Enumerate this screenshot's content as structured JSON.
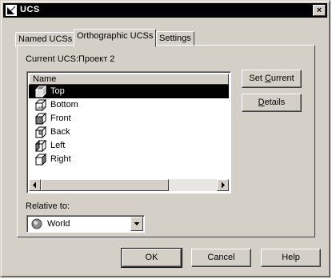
{
  "window": {
    "title": "UCS",
    "close_glyph": "×"
  },
  "tabs": [
    {
      "label": "Named UCSs"
    },
    {
      "label": "Orthographic UCSs",
      "active": true
    },
    {
      "label": "Settings"
    }
  ],
  "current_ucs": {
    "label": "Current UCS:",
    "value": "Проект 2"
  },
  "list": {
    "header": "Name",
    "items": [
      {
        "label": "Top",
        "icon": "cube-top-icon",
        "selected": true
      },
      {
        "label": "Bottom",
        "icon": "cube-bottom-icon"
      },
      {
        "label": "Front",
        "icon": "cube-front-icon"
      },
      {
        "label": "Back",
        "icon": "cube-back-icon"
      },
      {
        "label": "Left",
        "icon": "cube-left-icon"
      },
      {
        "label": "Right",
        "icon": "cube-right-icon"
      }
    ]
  },
  "side_buttons": {
    "set_current": {
      "pre": "Set ",
      "acc": "C",
      "post": "urrent"
    },
    "details": {
      "pre": "",
      "acc": "D",
      "post": "etails"
    }
  },
  "relative_to": {
    "label": "Relative to:",
    "value": "World",
    "icon": "globe-icon"
  },
  "footer": {
    "ok": "OK",
    "cancel": "Cancel",
    "help": "Help"
  },
  "colors": {
    "selection": "#000000",
    "face": "#d4d0c8",
    "titlebar": "#000000"
  }
}
